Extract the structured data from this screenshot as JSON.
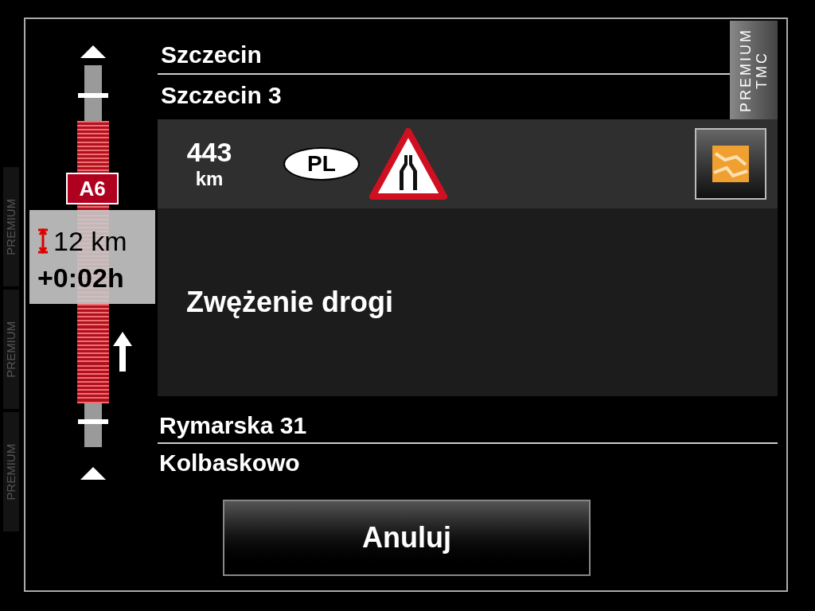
{
  "side_labels": [
    "PREMIUM",
    "PREMIUM",
    "PREMIUM"
  ],
  "tab_label": [
    "PREMIUM",
    "TMC"
  ],
  "road": "A6",
  "delay": {
    "length": "12 km",
    "time": "+0:02h"
  },
  "places_before": [
    "Szczecin",
    "Szczecin 3"
  ],
  "event": {
    "distance": "443",
    "unit": "km",
    "country": "PL",
    "description": "Zwężenie drogi"
  },
  "places_after": [
    "Rymarska 31",
    "Kolbaskowo"
  ],
  "buttons": [
    "Anuluj"
  ]
}
